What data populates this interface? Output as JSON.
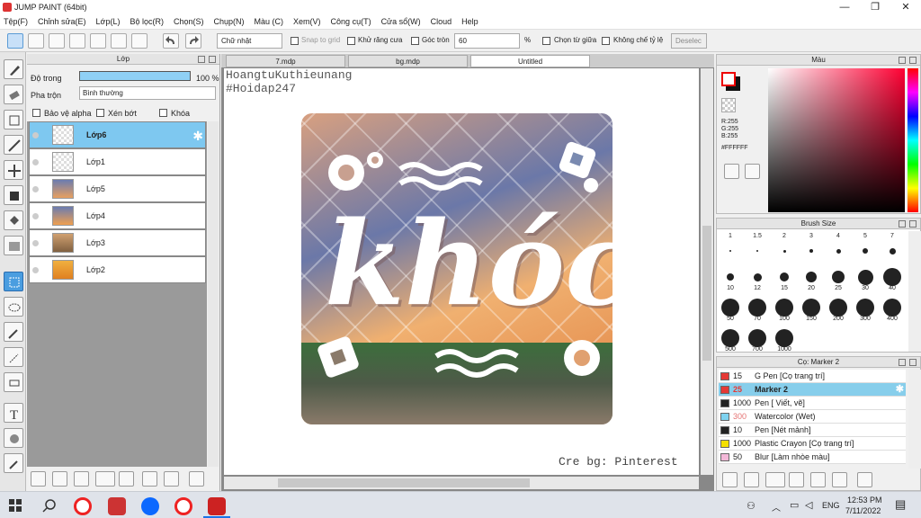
{
  "window": {
    "title": "JUMP PAINT (64bit)",
    "min": "—",
    "max": "❐",
    "close": "✕"
  },
  "menu": [
    "Tệp(F)",
    "Chỉnh sửa(E)",
    "Lớp(L)",
    "Bộ lọc(R)",
    "Chọn(S)",
    "Chụp(N)",
    "Màu (C)",
    "Xem(V)",
    "Công cụ(T)",
    "Cửa sổ(W)",
    "Cloud",
    "Help"
  ],
  "toolbar": {
    "shape": "Chữ nhật",
    "snap": "Snap to grid",
    "antialias": "Khử răng cưa",
    "round": "Góc tròn",
    "round_value": "60",
    "percent": "%",
    "select_center": "Chọn từ giữa",
    "fixed_ratio": "Không chế tỷ lệ",
    "deselect": "Deselec"
  },
  "layers": {
    "title": "Lớp",
    "opacity_label": "Độ trong",
    "opacity_value": "100 %",
    "blend_label": "Pha trộn",
    "blend_value": "Bình thường",
    "protect_alpha": "Bảo vệ alpha",
    "clip": "Xén bớt",
    "lock": "Khóa",
    "items": [
      {
        "name": "Lớp6",
        "selected": true
      },
      {
        "name": "Lớp1"
      },
      {
        "name": "Lớp5"
      },
      {
        "name": "Lớp4"
      },
      {
        "name": "Lớp3"
      },
      {
        "name": "Lớp2"
      }
    ]
  },
  "tabs": [
    "7.mdp",
    "bg.mdp",
    "Untitled"
  ],
  "canvas": {
    "watermark1": "HoangtuKuthieunang",
    "watermark2": "#Hoidap247",
    "credit": "Cre bg: Pinterest",
    "art_text": "khóc"
  },
  "color": {
    "title": "Màu",
    "r": "R:255",
    "g": "G:255",
    "b": "B:255",
    "hex": "#FFFFFF"
  },
  "brush_size": {
    "title": "Brush Size",
    "sizes": [
      "1",
      "1.5",
      "2",
      "3",
      "4",
      "5",
      "7",
      "10",
      "12",
      "15",
      "20",
      "25",
      "30",
      "40",
      "50",
      "70",
      "100",
      "150",
      "200",
      "300",
      "400",
      "500",
      "700",
      "1000"
    ]
  },
  "pens": {
    "title": "Cọ: Marker 2",
    "items": [
      {
        "size": "15",
        "name": "G Pen [Cọ trang trí]",
        "color": "#e53935"
      },
      {
        "size": "25",
        "name": "Marker 2",
        "color": "#e53935",
        "selected": true
      },
      {
        "size": "1000",
        "name": "Pen [ Viết, vẽ]",
        "color": "#222222"
      },
      {
        "size": "300",
        "name": "Watercolor (Wet)",
        "color": "#7fd3f0"
      },
      {
        "size": "10",
        "name": "Pen [Nét mảnh]",
        "color": "#222222"
      },
      {
        "size": "1000",
        "name": "Plastic Crayon [Cọ trang trí]",
        "color": "#f5e000"
      },
      {
        "size": "50",
        "name": "Blur [Làm nhòe màu]",
        "color": "#f3b8d8"
      }
    ]
  },
  "taskbar": {
    "lang": "ENG",
    "time": "12:53 PM",
    "date": "7/11/2022"
  }
}
